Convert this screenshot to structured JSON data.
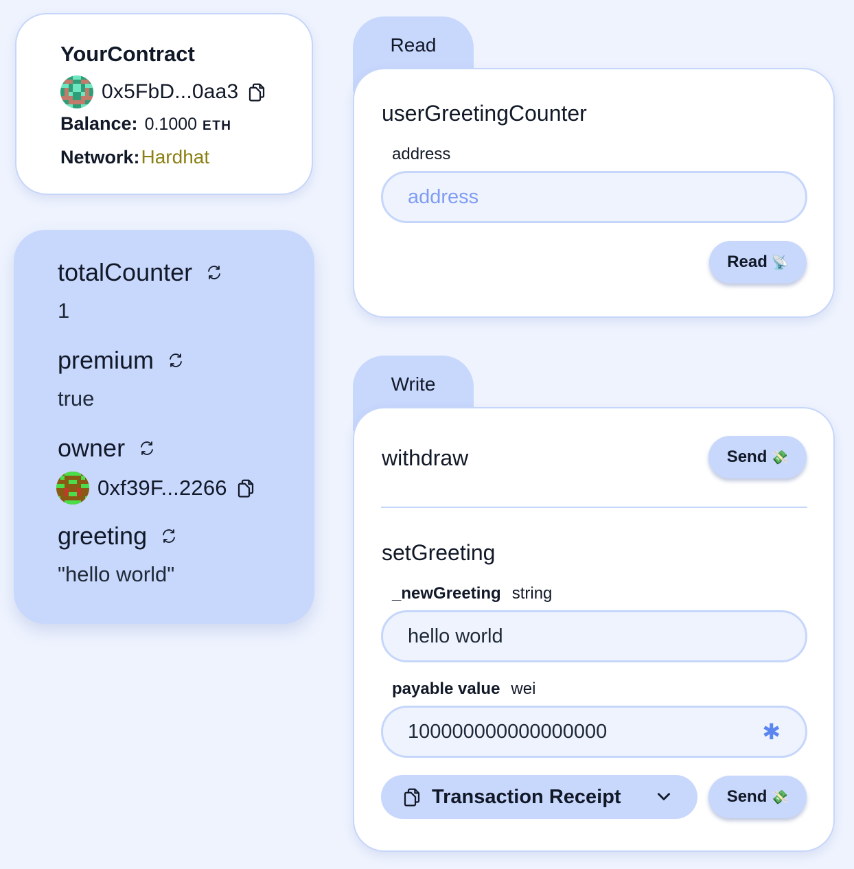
{
  "contract": {
    "name": "YourContract",
    "address": "0x5FbD...0aa3",
    "balance_label": "Balance:",
    "balance_value": "0.1000",
    "balance_unit": "ETH",
    "network_label": "Network:",
    "network_value": "Hardhat",
    "network_color": "#8a7f10"
  },
  "variables": [
    {
      "name": "totalCounter",
      "value": "1"
    },
    {
      "name": "premium",
      "value": "true"
    },
    {
      "name": "owner",
      "address": "0xf39F...2266"
    },
    {
      "name": "greeting",
      "value": "\"hello world\""
    }
  ],
  "read": {
    "tab_label": "Read",
    "function_name": "userGreetingCounter",
    "arg_label": "address",
    "arg_placeholder": "address",
    "button_label": "Read",
    "button_icon": "📡"
  },
  "write": {
    "tab_label": "Write",
    "withdraw": {
      "function_name": "withdraw",
      "button_label": "Send",
      "button_icon": "💸"
    },
    "setGreeting": {
      "function_name": "setGreeting",
      "arg_name": "_newGreeting",
      "arg_type": "string",
      "arg_value": "hello world",
      "payable_label": "payable value",
      "payable_unit": "wei",
      "payable_value": "100000000000000000",
      "payable_multiplier_icon": "✱",
      "receipt_label": "Transaction Receipt",
      "button_label": "Send",
      "button_icon": "💸"
    }
  },
  "colors": {
    "background": "#eef3fe",
    "card": "#ffffff",
    "accent": "#c8d7fc",
    "border": "#c6d6fb",
    "placeholder": "#7f9cf2"
  }
}
